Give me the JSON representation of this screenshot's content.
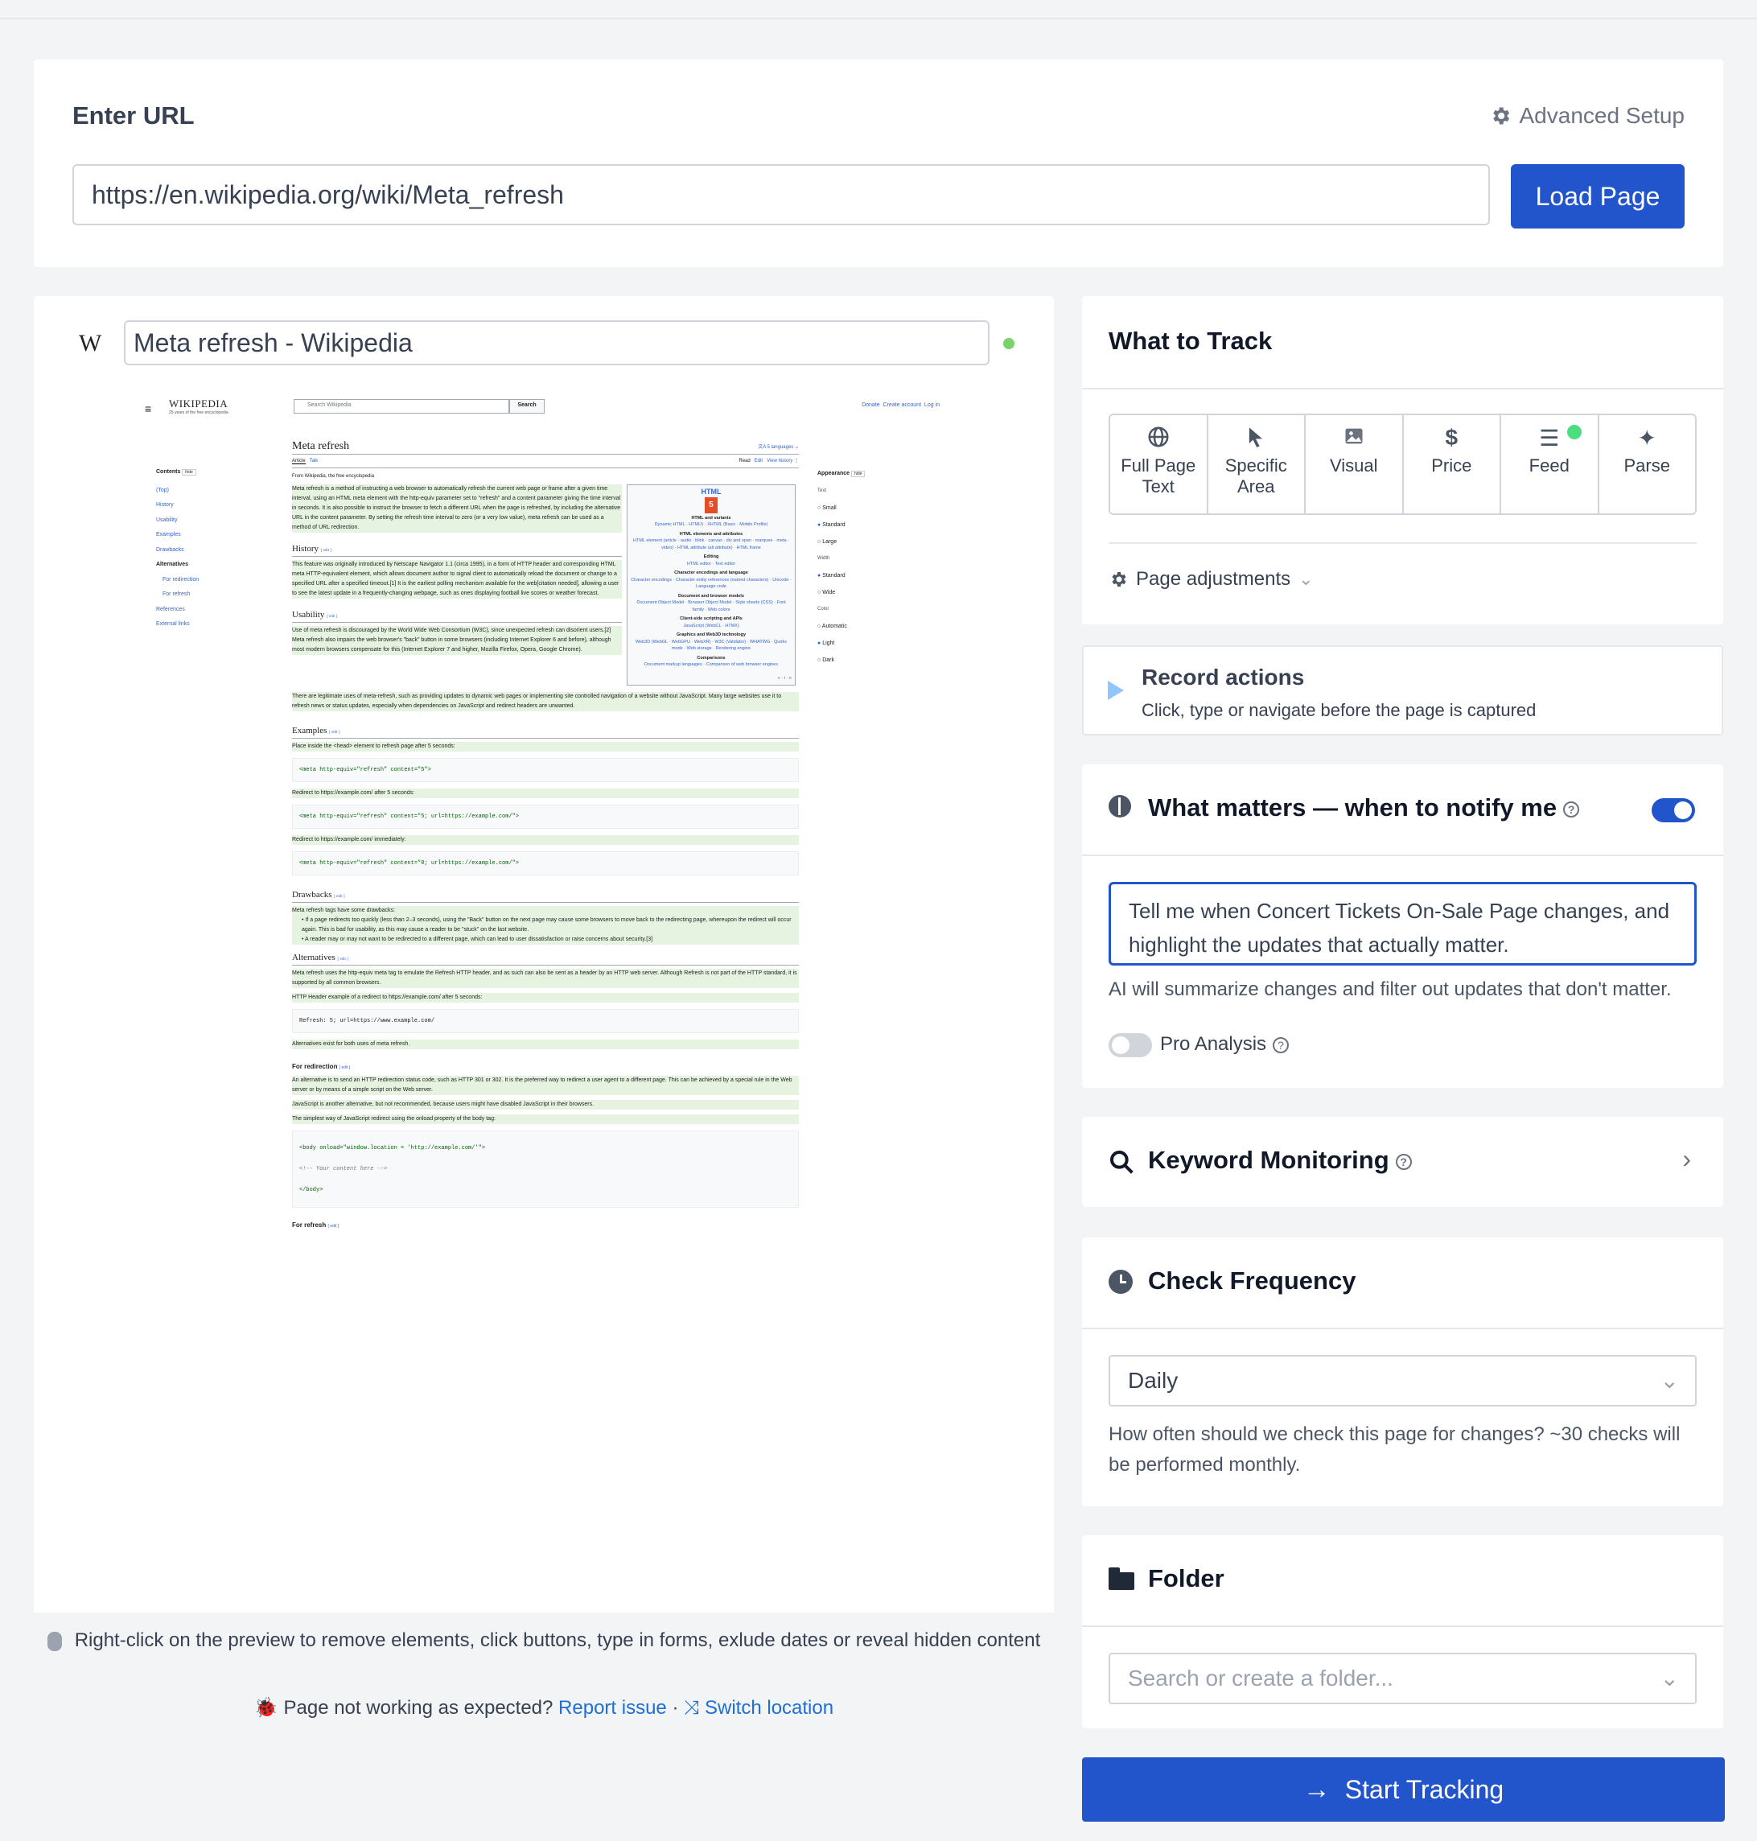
{
  "url_section": {
    "title": "Enter URL",
    "advanced_setup": "Advanced Setup",
    "url_value": "https://en.wikipedia.org/wiki/Meta_refresh",
    "load_button": "Load Page"
  },
  "preview": {
    "page_title": "Meta refresh - Wikipedia",
    "wiki": {
      "brand": "WIKIPEDIA",
      "tagline": "25 years of the free encyclopedia",
      "search_placeholder": "Search Wikipedia",
      "search_btn": "Search",
      "top_links": [
        "Donate",
        "Create account",
        "Log in"
      ],
      "article_title": "Meta refresh",
      "languages": "5 languages",
      "tabs": [
        "Article",
        "Talk"
      ],
      "actions": [
        "Read",
        "Edit",
        "View history"
      ],
      "from": "From Wikipedia, the free encyclopedia",
      "contents_title": "Contents",
      "contents_hide": "hide",
      "contents": [
        "(Top)",
        "History",
        "Usability",
        "Examples",
        "Drawbacks",
        "Alternatives",
        "For redirection",
        "For refresh",
        "References",
        "External links"
      ],
      "appearance_title": "Appearance",
      "appearance_hide": "hide",
      "text_label": "Text",
      "text_opts": [
        "Small",
        "Standard",
        "Large"
      ],
      "width_label": "Width",
      "width_opts": [
        "Standard",
        "Wide"
      ],
      "color_label": "Color",
      "color_opts": [
        "Automatic",
        "Light",
        "Dark"
      ],
      "intro": "Meta refresh is a method of instructing a web browser to automatically refresh the current web page or frame after a given time interval, using an HTML meta element with the http-equiv parameter set to \"refresh\" and a content parameter giving the time interval in seconds. It is also possible to instruct the browser to fetch a different URL when the page is refreshed, by including the alternative URL in the content parameter. By setting the refresh time interval to zero (or a very low value), meta refresh can be used as a method of URL redirection.",
      "infobox_title": "HTML",
      "infobox_lines": [
        "HTML and variants",
        "Dynamic HTML · HTML5 · XHTML (Basic · Mobile Profile)",
        "HTML elements and attributes",
        "HTML element (article · audio · blink · canvas · div and span · marquee · meta · video) · HTML attribute (alt attribute) · HTML frame",
        "Editing",
        "HTML editor · Text editor",
        "Character encodings and language",
        "Character encodings · Character entity references (named characters) · Unicode · Language code",
        "Document and browser models",
        "Document Object Model · Browser Object Model · Style sheets (CSS) · Font family · Web colors",
        "Client-side scripting and APIs",
        "JavaScript (WebCL · HTMX)",
        "Graphics and Web3D technology",
        "Web3D (WebGL · WebGPU · WebXR) · W3C (Validator) · WHATWG · Quirks mode · Web storage · Rendering engine",
        "Comparisons",
        "Document markup languages · Comparison of web browser engines"
      ],
      "h_history": "History",
      "p_history": "This feature was originally introduced by Netscape Navigator 1.1 (circa 1995), in a form of HTTP header and corresponding HTML meta HTTP-equivalent element, which allows document author to signal client to automatically reload the document or change to a specified URL after a specified timeout.[1] It is the earliest polling mechanism available for the web[citation needed], allowing a user to see the latest update in a frequently-changing webpage, such as ones displaying football live scores or weather forecast.",
      "h_usability": "Usability",
      "p_usability": "Use of meta refresh is discouraged by the World Wide Web Consortium (W3C), since unexpected refresh can disorient users.[2] Meta refresh also impairs the web browser's \"back\" button in some browsers (including Internet Explorer 6 and before), although most modern browsers compensate for this (Internet Explorer 7 and higher, Mozilla Firefox, Opera, Google Chrome).",
      "p_usability2": "There are legitimate uses of meta-refresh, such as providing updates to dynamic web pages or implementing site controlled navigation of a website without JavaScript. Many large websites use it to refresh news or status updates, especially when dependencies on JavaScript and redirect headers are unwanted.",
      "h_examples": "Examples",
      "p_ex1": "Place inside the <head> element to refresh page after 5 seconds:",
      "code1": "<meta http-equiv=\"refresh\" content=\"5\">",
      "p_ex2": "Redirect to https://example.com/ after 5 seconds:",
      "code2": "<meta http-equiv=\"refresh\" content=\"5; url=https://example.com/\">",
      "p_ex3": "Redirect to https://example.com/ immediately:",
      "code3": "<meta http-equiv=\"refresh\" content=\"0; url=https://example.com/\">",
      "h_drawbacks": "Drawbacks",
      "p_drawbacks": "Meta refresh tags have some drawbacks:",
      "li_draw1": "If a page redirects too quickly (less than 2–3 seconds), using the \"Back\" button on the next page may cause some browsers to move back to the redirecting page, whereupon the redirect will occur again. This is bad for usability, as this may cause a reader to be \"stuck\" on the last website.",
      "li_draw2": "A reader may or may not want to be redirected to a different page, which can lead to user dissatisfaction or raise concerns about security.[3]",
      "h_alternatives": "Alternatives",
      "p_alt1": "Meta refresh uses the http-equiv meta tag to emulate the Refresh HTTP header, and as such can also be sent as a header by an HTTP web server. Although Refresh is not part of the HTTP standard, it is supported by all common browsers.",
      "p_alt2": "HTTP Header example of a redirect to https://example.com/ after 5 seconds:",
      "code4": "Refresh: 5; url=https://www.example.com/",
      "p_alt3": "Alternatives exist for both uses of meta refresh.",
      "h_for_redirection": "For redirection",
      "p_red1": "An alternative is to send an HTTP redirection status code, such as HTTP 301 or 302. It is the preferred way to redirect a user agent to a different page. This can be achieved by a special rule in the Web server or by means of a simple script on the Web server.",
      "p_red2": "JavaScript is another alternative, but not recommended, because users might have disabled JavaScript in their browsers.",
      "p_red3": "The simplest way of JavaScript redirect using the onload property of the body tag:",
      "code5a": "<body onload=\"window.location = 'http://example.com/'\">",
      "code5b": "<!-- Your content here -->",
      "code5c": "</body>",
      "h_for_refresh": "For refresh",
      "edit": "edit",
      "vte": "v · t · e"
    },
    "hint": "Right-click on the preview to remove elements, click buttons, type in forms, exlude dates or reveal hidden content",
    "issue_text": "Page not working as expected?",
    "report_issue": "Report issue",
    "separator": "·",
    "switch_location": "Switch location"
  },
  "what_to_track": {
    "title": "What to Track",
    "options": [
      {
        "label": "Full Page Text",
        "icon": "globe-icon"
      },
      {
        "label": "Specific Area",
        "icon": "cursor-icon"
      },
      {
        "label": "Visual",
        "icon": "image-icon"
      },
      {
        "label": "Price",
        "icon": "dollar-icon"
      },
      {
        "label": "Feed",
        "icon": "list-icon"
      },
      {
        "label": "Parse",
        "icon": "sparkle-icon"
      }
    ],
    "page_adjustments": "Page adjustments"
  },
  "record_actions": {
    "title": "Record actions",
    "subtitle": "Click, type or navigate before the page is captured"
  },
  "what_matters": {
    "title": "What matters — when to notify me",
    "toggle_on": true,
    "prompt": "Tell me when Concert Tickets On-Sale Page changes, and highlight the updates that actually matter.",
    "helper": "AI will summarize changes and filter out updates that don't matter.",
    "pro_analysis": "Pro Analysis",
    "pro_on": false
  },
  "keyword_monitoring": {
    "title": "Keyword Monitoring"
  },
  "check_frequency": {
    "title": "Check Frequency",
    "selected": "Daily",
    "helper": "How often should we check this page for changes? ~30 checks will be performed monthly."
  },
  "folder": {
    "title": "Folder",
    "placeholder": "Search or create a folder..."
  },
  "start_button": "Start Tracking",
  "colors": {
    "primary": "#2255cc",
    "link": "#1d6fd6",
    "wiki_highlight": "#e6f3e0",
    "status_green": "#7bd36a"
  }
}
